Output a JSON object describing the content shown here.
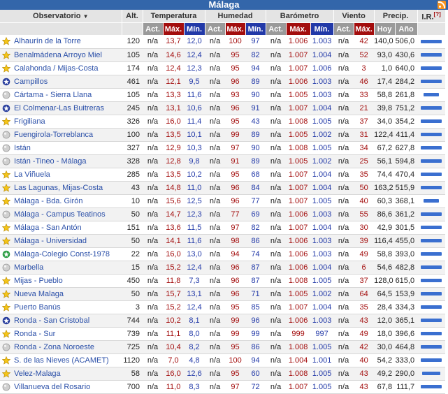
{
  "title": "Málaga",
  "headers": {
    "observatorio": "Observatorio",
    "alt": "Alt.",
    "temperatura": "Temperatura",
    "humedad": "Humedad",
    "barometro": "Barómetro",
    "viento": "Viento",
    "precip": "Precip.",
    "ir": "I.R.",
    "ir_note": "[?]",
    "act": "Act.",
    "max": "Máx.",
    "min": "Mín.",
    "hoy": "Hoy",
    "ano": "Año"
  },
  "icons": {
    "star": "star-icon",
    "circle": "gray-circle-icon",
    "globe": "blue-globe-icon",
    "green": "green-star-icon"
  },
  "rows": [
    {
      "icon": "star",
      "name": "Alhaurín de la Torre",
      "alt": "120",
      "t_act": "n/a",
      "t_max": "13,7",
      "t_min": "12,0",
      "h_act": "n/a",
      "h_max": "100",
      "h_min": "97",
      "b_act": "n/a",
      "b_max": "1.006",
      "b_min": "1.003",
      "v_act": "n/a",
      "v_max": "42",
      "p_hoy": "140,0",
      "p_ano": "506,0",
      "ir": 0.95
    },
    {
      "icon": "star",
      "name": "Benalmádena Arroyo Miel",
      "alt": "105",
      "t_act": "n/a",
      "t_max": "14,6",
      "t_min": "12,4",
      "h_act": "n/a",
      "h_max": "95",
      "h_min": "82",
      "b_act": "n/a",
      "b_max": "1.007",
      "b_min": "1.004",
      "v_act": "n/a",
      "v_max": "52",
      "p_hoy": "93,0",
      "p_ano": "430,6",
      "ir": 0.95
    },
    {
      "icon": "star",
      "name": "Calahonda / Mijas-Costa",
      "alt": "174",
      "t_act": "n/a",
      "t_max": "12,4",
      "t_min": "12,3",
      "h_act": "n/a",
      "h_max": "95",
      "h_min": "94",
      "b_act": "n/a",
      "b_max": "1.007",
      "b_min": "1.006",
      "v_act": "n/a",
      "v_max": "3",
      "p_hoy": "1,0",
      "p_ano": "640,0",
      "ir": 0.95
    },
    {
      "icon": "globe",
      "name": "Campillos",
      "alt": "461",
      "t_act": "n/a",
      "t_max": "12,1",
      "t_min": "9,5",
      "h_act": "n/a",
      "h_max": "96",
      "h_min": "89",
      "b_act": "n/a",
      "b_max": "1.006",
      "b_min": "1.003",
      "v_act": "n/a",
      "v_max": "46",
      "p_hoy": "17,4",
      "p_ano": "284,2",
      "ir": 0.95
    },
    {
      "icon": "circle",
      "name": "Cártama - Sierra Llana",
      "alt": "105",
      "t_act": "n/a",
      "t_max": "13,3",
      "t_min": "11,6",
      "h_act": "n/a",
      "h_max": "93",
      "h_min": "90",
      "b_act": "n/a",
      "b_max": "1.005",
      "b_min": "1.003",
      "v_act": "n/a",
      "v_max": "33",
      "p_hoy": "58,8",
      "p_ano": "261,8",
      "ir": 0.7
    },
    {
      "icon": "globe",
      "name": "El Colmenar-Las Buitreras",
      "alt": "245",
      "t_act": "n/a",
      "t_max": "13,1",
      "t_min": "10,6",
      "h_act": "n/a",
      "h_max": "96",
      "h_min": "91",
      "b_act": "n/a",
      "b_max": "1.007",
      "b_min": "1.004",
      "v_act": "n/a",
      "v_max": "21",
      "p_hoy": "39,8",
      "p_ano": "751,2",
      "ir": 0.95
    },
    {
      "icon": "star",
      "name": "Frigiliana",
      "alt": "326",
      "t_act": "n/a",
      "t_max": "16,0",
      "t_min": "11,4",
      "h_act": "n/a",
      "h_max": "95",
      "h_min": "43",
      "b_act": "n/a",
      "b_max": "1.008",
      "b_min": "1.005",
      "v_act": "n/a",
      "v_max": "37",
      "p_hoy": "34,0",
      "p_ano": "354,2",
      "ir": 0.95
    },
    {
      "icon": "circle",
      "name": "Fuengirola-Torreblanca",
      "alt": "100",
      "t_act": "n/a",
      "t_max": "13,5",
      "t_min": "10,1",
      "h_act": "n/a",
      "h_max": "99",
      "h_min": "89",
      "b_act": "n/a",
      "b_max": "1.005",
      "b_min": "1.002",
      "v_act": "n/a",
      "v_max": "31",
      "p_hoy": "122,4",
      "p_ano": "411,4",
      "ir": 0.95
    },
    {
      "icon": "circle",
      "name": "Istán",
      "alt": "327",
      "t_act": "n/a",
      "t_max": "12,9",
      "t_min": "10,3",
      "h_act": "n/a",
      "h_max": "97",
      "h_min": "90",
      "b_act": "n/a",
      "b_max": "1.008",
      "b_min": "1.005",
      "v_act": "n/a",
      "v_max": "34",
      "p_hoy": "67,2",
      "p_ano": "627,8",
      "ir": 0.95
    },
    {
      "icon": "circle",
      "name": "Istán -Tineo - Málaga",
      "alt": "328",
      "t_act": "n/a",
      "t_max": "12,8",
      "t_min": "9,8",
      "h_act": "n/a",
      "h_max": "91",
      "h_min": "89",
      "b_act": "n/a",
      "b_max": "1.005",
      "b_min": "1.002",
      "v_act": "n/a",
      "v_max": "25",
      "p_hoy": "56,1",
      "p_ano": "594,8",
      "ir": 0.95
    },
    {
      "icon": "star",
      "name": "La Viñuela",
      "alt": "285",
      "t_act": "n/a",
      "t_max": "13,5",
      "t_min": "10,2",
      "h_act": "n/a",
      "h_max": "95",
      "h_min": "68",
      "b_act": "n/a",
      "b_max": "1.007",
      "b_min": "1.004",
      "v_act": "n/a",
      "v_max": "35",
      "p_hoy": "74,4",
      "p_ano": "470,4",
      "ir": 0.95
    },
    {
      "icon": "star",
      "name": "Las Lagunas, Mijas-Costa",
      "alt": "43",
      "t_act": "n/a",
      "t_max": "14,8",
      "t_min": "11,0",
      "h_act": "n/a",
      "h_max": "96",
      "h_min": "84",
      "b_act": "n/a",
      "b_max": "1.007",
      "b_min": "1.004",
      "v_act": "n/a",
      "v_max": "50",
      "p_hoy": "163,2",
      "p_ano": "515,9",
      "ir": 0.95
    },
    {
      "icon": "star",
      "name": "Málaga - Bda. Girón",
      "alt": "10",
      "t_act": "n/a",
      "t_max": "15,6",
      "t_min": "12,5",
      "h_act": "n/a",
      "h_max": "96",
      "h_min": "77",
      "b_act": "n/a",
      "b_max": "1.007",
      "b_min": "1.005",
      "v_act": "n/a",
      "v_max": "40",
      "p_hoy": "60,3",
      "p_ano": "368,1",
      "ir": 0.7
    },
    {
      "icon": "circle",
      "name": "Málaga - Campus Teatinos",
      "alt": "50",
      "t_act": "n/a",
      "t_max": "14,7",
      "t_min": "12,3",
      "h_act": "n/a",
      "h_max": "77",
      "h_min": "69",
      "b_act": "n/a",
      "b_max": "1.006",
      "b_min": "1.003",
      "v_act": "n/a",
      "v_max": "55",
      "p_hoy": "86,6",
      "p_ano": "361,2",
      "ir": 0.95
    },
    {
      "icon": "star",
      "name": "Málaga - San Antón",
      "alt": "151",
      "t_act": "n/a",
      "t_max": "13,6",
      "t_min": "11,5",
      "h_act": "n/a",
      "h_max": "97",
      "h_min": "82",
      "b_act": "n/a",
      "b_max": "1.007",
      "b_min": "1.004",
      "v_act": "n/a",
      "v_max": "30",
      "p_hoy": "42,9",
      "p_ano": "301,5",
      "ir": 0.95
    },
    {
      "icon": "star",
      "name": "Málaga - Universidad",
      "alt": "50",
      "t_act": "n/a",
      "t_max": "14,1",
      "t_min": "11,6",
      "h_act": "n/a",
      "h_max": "98",
      "h_min": "86",
      "b_act": "n/a",
      "b_max": "1.006",
      "b_min": "1.003",
      "v_act": "n/a",
      "v_max": "39",
      "p_hoy": "116,4",
      "p_ano": "455,0",
      "ir": 0.95
    },
    {
      "icon": "green",
      "name": "Málaga-Colegio Const-1978",
      "alt": "22",
      "t_act": "n/a",
      "t_max": "16,0",
      "t_min": "13,0",
      "h_act": "n/a",
      "h_max": "94",
      "h_min": "74",
      "b_act": "n/a",
      "b_max": "1.006",
      "b_min": "1.003",
      "v_act": "n/a",
      "v_max": "49",
      "p_hoy": "58,8",
      "p_ano": "393,0",
      "ir": 0.95
    },
    {
      "icon": "circle",
      "name": "Marbella",
      "alt": "15",
      "t_act": "n/a",
      "t_max": "15,2",
      "t_min": "12,4",
      "h_act": "n/a",
      "h_max": "96",
      "h_min": "87",
      "b_act": "n/a",
      "b_max": "1.006",
      "b_min": "1.004",
      "v_act": "n/a",
      "v_max": "6",
      "p_hoy": "54,6",
      "p_ano": "482,8",
      "ir": 0.95
    },
    {
      "icon": "star",
      "name": "Mijas - Pueblo",
      "alt": "450",
      "t_act": "n/a",
      "t_max": "11,8",
      "t_min": "7,3",
      "h_act": "n/a",
      "h_max": "96",
      "h_min": "87",
      "b_act": "n/a",
      "b_max": "1.008",
      "b_min": "1.005",
      "v_act": "n/a",
      "v_max": "37",
      "p_hoy": "128,0",
      "p_ano": "615,0",
      "ir": 0.95
    },
    {
      "icon": "star",
      "name": "Nueva Malaga",
      "alt": "50",
      "t_act": "n/a",
      "t_max": "15,7",
      "t_min": "13,1",
      "h_act": "n/a",
      "h_max": "96",
      "h_min": "71",
      "b_act": "n/a",
      "b_max": "1.005",
      "b_min": "1.002",
      "v_act": "n/a",
      "v_max": "64",
      "p_hoy": "64,5",
      "p_ano": "153,9",
      "ir": 0.95
    },
    {
      "icon": "star",
      "name": "Puerto Banús",
      "alt": "3",
      "t_act": "n/a",
      "t_max": "15,2",
      "t_min": "12,4",
      "h_act": "n/a",
      "h_max": "95",
      "h_min": "85",
      "b_act": "n/a",
      "b_max": "1.007",
      "b_min": "1.004",
      "v_act": "n/a",
      "v_max": "35",
      "p_hoy": "28,4",
      "p_ano": "334,3",
      "ir": 0.95
    },
    {
      "icon": "globe",
      "name": "Ronda - San Cristobal",
      "alt": "744",
      "t_act": "n/a",
      "t_max": "10,2",
      "t_min": "8,1",
      "h_act": "n/a",
      "h_max": "99",
      "h_min": "96",
      "b_act": "n/a",
      "b_max": "1.006",
      "b_min": "1.003",
      "v_act": "n/a",
      "v_max": "43",
      "p_hoy": "12,0",
      "p_ano": "365,1",
      "ir": 0.95
    },
    {
      "icon": "star",
      "name": "Ronda - Sur",
      "alt": "739",
      "t_act": "n/a",
      "t_max": "11,1",
      "t_min": "8,0",
      "h_act": "n/a",
      "h_max": "99",
      "h_min": "99",
      "b_act": "n/a",
      "b_max": "999",
      "b_min": "997",
      "v_act": "n/a",
      "v_max": "49",
      "p_hoy": "18,0",
      "p_ano": "396,6",
      "ir": 0.95
    },
    {
      "icon": "circle",
      "name": "Ronda - Zona Noroeste",
      "alt": "725",
      "t_act": "n/a",
      "t_max": "10,4",
      "t_min": "8,2",
      "h_act": "n/a",
      "h_max": "95",
      "h_min": "86",
      "b_act": "n/a",
      "b_max": "1.008",
      "b_min": "1.005",
      "v_act": "n/a",
      "v_max": "42",
      "p_hoy": "30,0",
      "p_ano": "464,8",
      "ir": 0.95
    },
    {
      "icon": "star",
      "name": "S. de las Nieves (ACAMET)",
      "alt": "1120",
      "t_act": "n/a",
      "t_max": "7,0",
      "t_min": "4,8",
      "h_act": "n/a",
      "h_max": "100",
      "h_min": "94",
      "b_act": "n/a",
      "b_max": "1.004",
      "b_min": "1.001",
      "v_act": "n/a",
      "v_max": "40",
      "p_hoy": "54,2",
      "p_ano": "333,0",
      "ir": 0.95
    },
    {
      "icon": "star",
      "name": "Velez-Malaga",
      "alt": "58",
      "t_act": "n/a",
      "t_max": "16,0",
      "t_min": "12,6",
      "h_act": "n/a",
      "h_max": "95",
      "h_min": "60",
      "b_act": "n/a",
      "b_max": "1.008",
      "b_min": "1.005",
      "v_act": "n/a",
      "v_max": "43",
      "p_hoy": "49,2",
      "p_ano": "290,0",
      "ir": 0.8
    },
    {
      "icon": "circle",
      "name": "Villanueva del Rosario",
      "alt": "700",
      "t_act": "n/a",
      "t_max": "11,0",
      "t_min": "8,3",
      "h_act": "n/a",
      "h_max": "97",
      "h_min": "72",
      "b_act": "n/a",
      "b_max": "1.007",
      "b_min": "1.005",
      "v_act": "n/a",
      "v_max": "43",
      "p_hoy": "67,8",
      "p_ano": "111,7",
      "ir": 0.95
    }
  ]
}
